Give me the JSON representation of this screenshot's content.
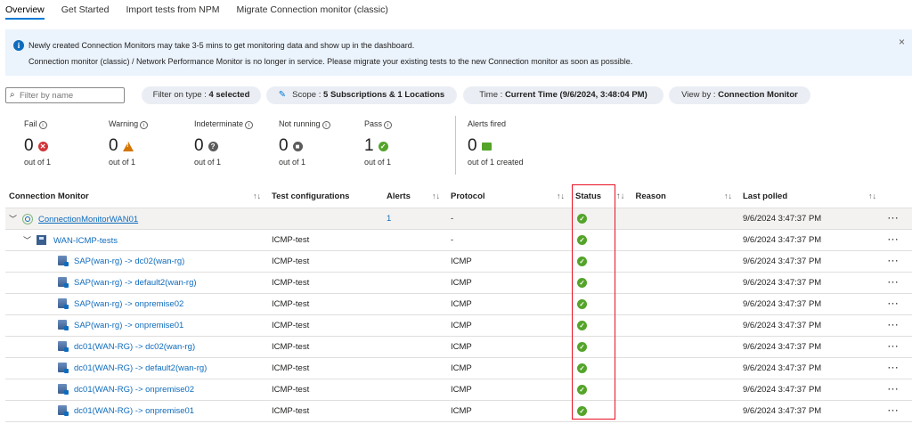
{
  "tabs": [
    "Overview",
    "Get Started",
    "Import tests from NPM",
    "Migrate Connection monitor (classic)"
  ],
  "banner": {
    "line1": "Newly created Connection Monitors may take 3-5 mins to get monitoring data and show up in the dashboard.",
    "line2": "Connection monitor (classic) / Network Performance Monitor is no longer in service. Please migrate your existing tests to the new Connection monitor as soon as possible.",
    "close": "×"
  },
  "filter": {
    "placeholder": "Filter by name"
  },
  "pills": {
    "type_prefix": "Filter on type : ",
    "type_value": "4 selected",
    "scope_prefix": "Scope : ",
    "scope_value": "5 Subscriptions & 1 Locations",
    "time_prefix": "Time : ",
    "time_value": "Current Time (9/6/2024, 3:48:04 PM)",
    "view_prefix": "View by : ",
    "view_value": "Connection Monitor"
  },
  "stats": {
    "fail": {
      "label": "Fail",
      "value": "0",
      "sub": "out of 1"
    },
    "warning": {
      "label": "Warning",
      "value": "0",
      "sub": "out of 1"
    },
    "indeterminate": {
      "label": "Indeterminate",
      "value": "0",
      "sub": "out of 1"
    },
    "not_running": {
      "label": "Not running",
      "value": "0",
      "sub": "out of 1"
    },
    "pass": {
      "label": "Pass",
      "value": "1",
      "sub": "out of 1"
    },
    "alerts": {
      "label": "Alerts fired",
      "value": "0",
      "sub": "out of 1 created"
    }
  },
  "table": {
    "headers": {
      "monitor": "Connection Monitor",
      "config": "Test configurations",
      "alerts": "Alerts",
      "protocol": "Protocol",
      "status": "Status",
      "reason": "Reason",
      "polled": "Last polled",
      "sort": "↑↓"
    },
    "rows": [
      {
        "name": "ConnectionMonitorWAN01",
        "config": "",
        "alerts": "1",
        "protocol": "-",
        "polled": "9/6/2024 3:47:37 PM"
      },
      {
        "name": "WAN-ICMP-tests",
        "config": "ICMP-test",
        "alerts": "",
        "protocol": "-",
        "polled": "9/6/2024 3:47:37 PM"
      },
      {
        "name": "SAP(wan-rg) -> dc02(wan-rg)",
        "config": "ICMP-test",
        "alerts": "",
        "protocol": "ICMP",
        "polled": "9/6/2024 3:47:37 PM"
      },
      {
        "name": "SAP(wan-rg) -> default2(wan-rg)",
        "config": "ICMP-test",
        "alerts": "",
        "protocol": "ICMP",
        "polled": "9/6/2024 3:47:37 PM"
      },
      {
        "name": "SAP(wan-rg) -> onpremise02",
        "config": "ICMP-test",
        "alerts": "",
        "protocol": "ICMP",
        "polled": "9/6/2024 3:47:37 PM"
      },
      {
        "name": "SAP(wan-rg) -> onpremise01",
        "config": "ICMP-test",
        "alerts": "",
        "protocol": "ICMP",
        "polled": "9/6/2024 3:47:37 PM"
      },
      {
        "name": "dc01(WAN-RG) -> dc02(wan-rg)",
        "config": "ICMP-test",
        "alerts": "",
        "protocol": "ICMP",
        "polled": "9/6/2024 3:47:37 PM"
      },
      {
        "name": "dc01(WAN-RG) -> default2(wan-rg)",
        "config": "ICMP-test",
        "alerts": "",
        "protocol": "ICMP",
        "polled": "9/6/2024 3:47:37 PM"
      },
      {
        "name": "dc01(WAN-RG) -> onpremise02",
        "config": "ICMP-test",
        "alerts": "",
        "protocol": "ICMP",
        "polled": "9/6/2024 3:47:37 PM"
      },
      {
        "name": "dc01(WAN-RG) -> onpremise01",
        "config": "ICMP-test",
        "alerts": "",
        "protocol": "ICMP",
        "polled": "9/6/2024 3:47:37 PM"
      }
    ],
    "more": "···"
  },
  "colors": {
    "accent": "#0078d4",
    "pass": "#54a42a",
    "fail": "#d13438",
    "warning": "#d47500",
    "highlight": "#e81123"
  }
}
